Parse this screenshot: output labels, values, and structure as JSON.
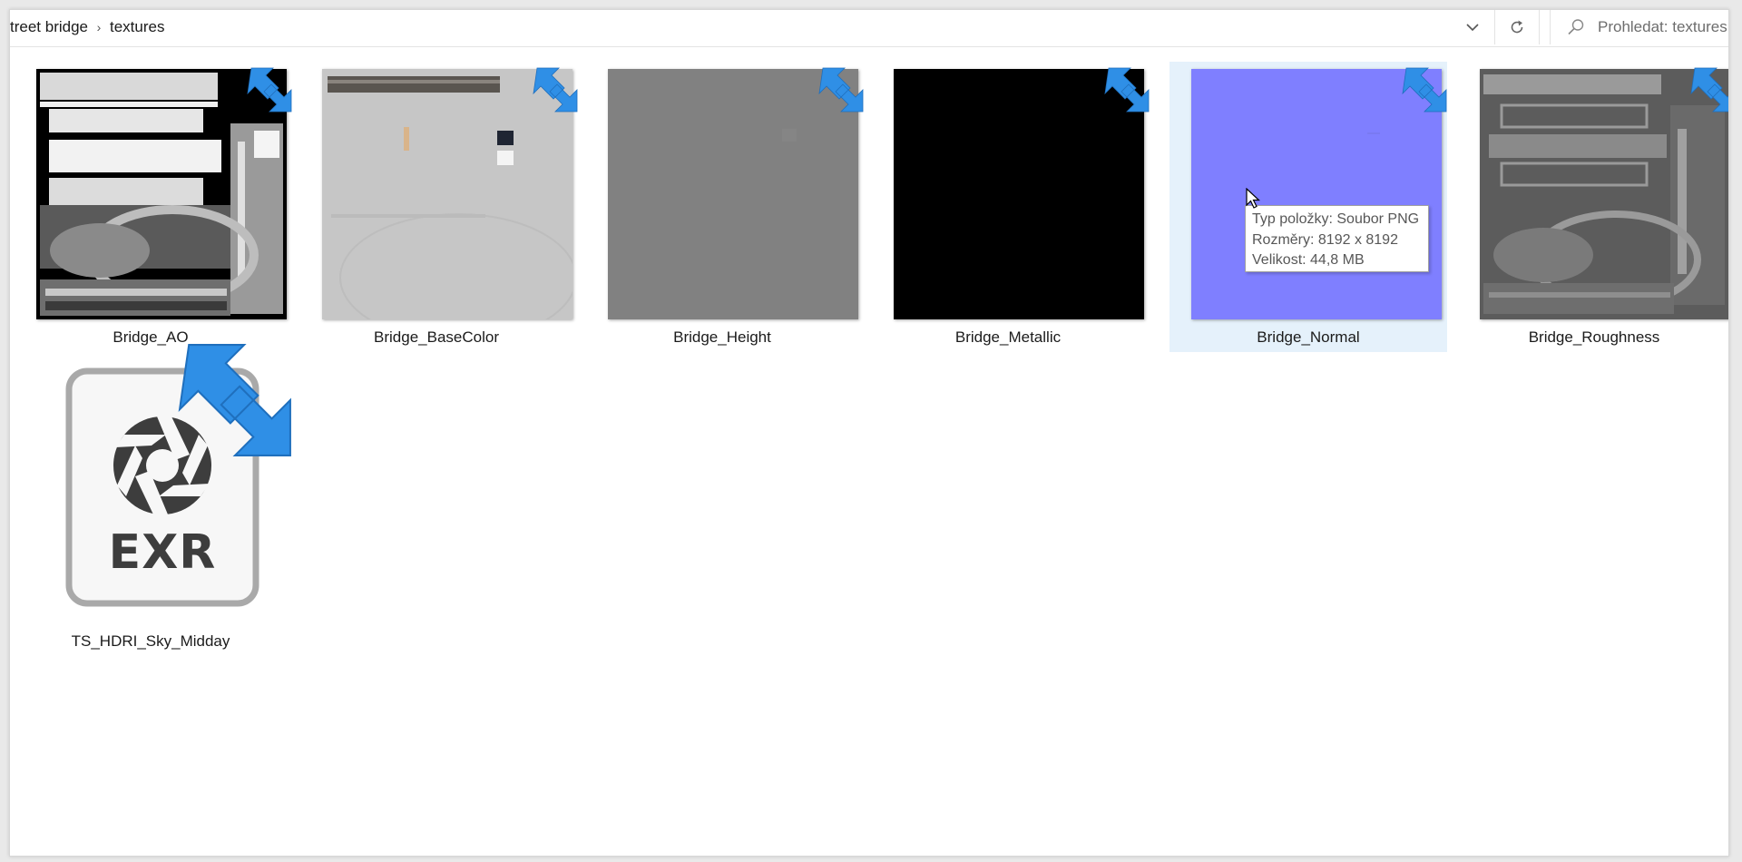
{
  "address_bar": {
    "breadcrumb": [
      "treet bridge",
      "textures"
    ],
    "search_placeholder": "Prohledat: textures"
  },
  "files": [
    {
      "name": "Bridge_AO",
      "type": "png",
      "icon": "texture-thumbnail-ao"
    },
    {
      "name": "Bridge_BaseColor",
      "type": "png",
      "icon": "texture-thumbnail-basecolor"
    },
    {
      "name": "Bridge_Height",
      "type": "png",
      "icon": "texture-thumbnail-height"
    },
    {
      "name": "Bridge_Metallic",
      "type": "png",
      "icon": "texture-thumbnail-metallic"
    },
    {
      "name": "Bridge_Normal",
      "type": "png",
      "icon": "texture-thumbnail-normal",
      "selected": true
    },
    {
      "name": "Bridge_Roughness",
      "type": "png",
      "icon": "texture-thumbnail-roughness"
    },
    {
      "name": "TS_HDRI_Sky_Midday",
      "type": "exr",
      "icon": "exr-file-icon",
      "icon_text": "EXR"
    }
  ],
  "tooltip": {
    "lines": [
      "Typ položky: Soubor PNG",
      "Rozměry: 8192 x 8192",
      "Velikost: 44,8 MB"
    ]
  },
  "icons": {
    "compressed_badge": "compressed-arrows-icon",
    "history_dropdown": "chevron-down-icon",
    "refresh": "refresh-icon",
    "search": "search-icon"
  },
  "colors": {
    "badge_blue": "#2f8fe6",
    "selection": "#e5f1fb",
    "normal_map": "#7f7fff",
    "exr_icon_dark": "#3d3d3d"
  }
}
